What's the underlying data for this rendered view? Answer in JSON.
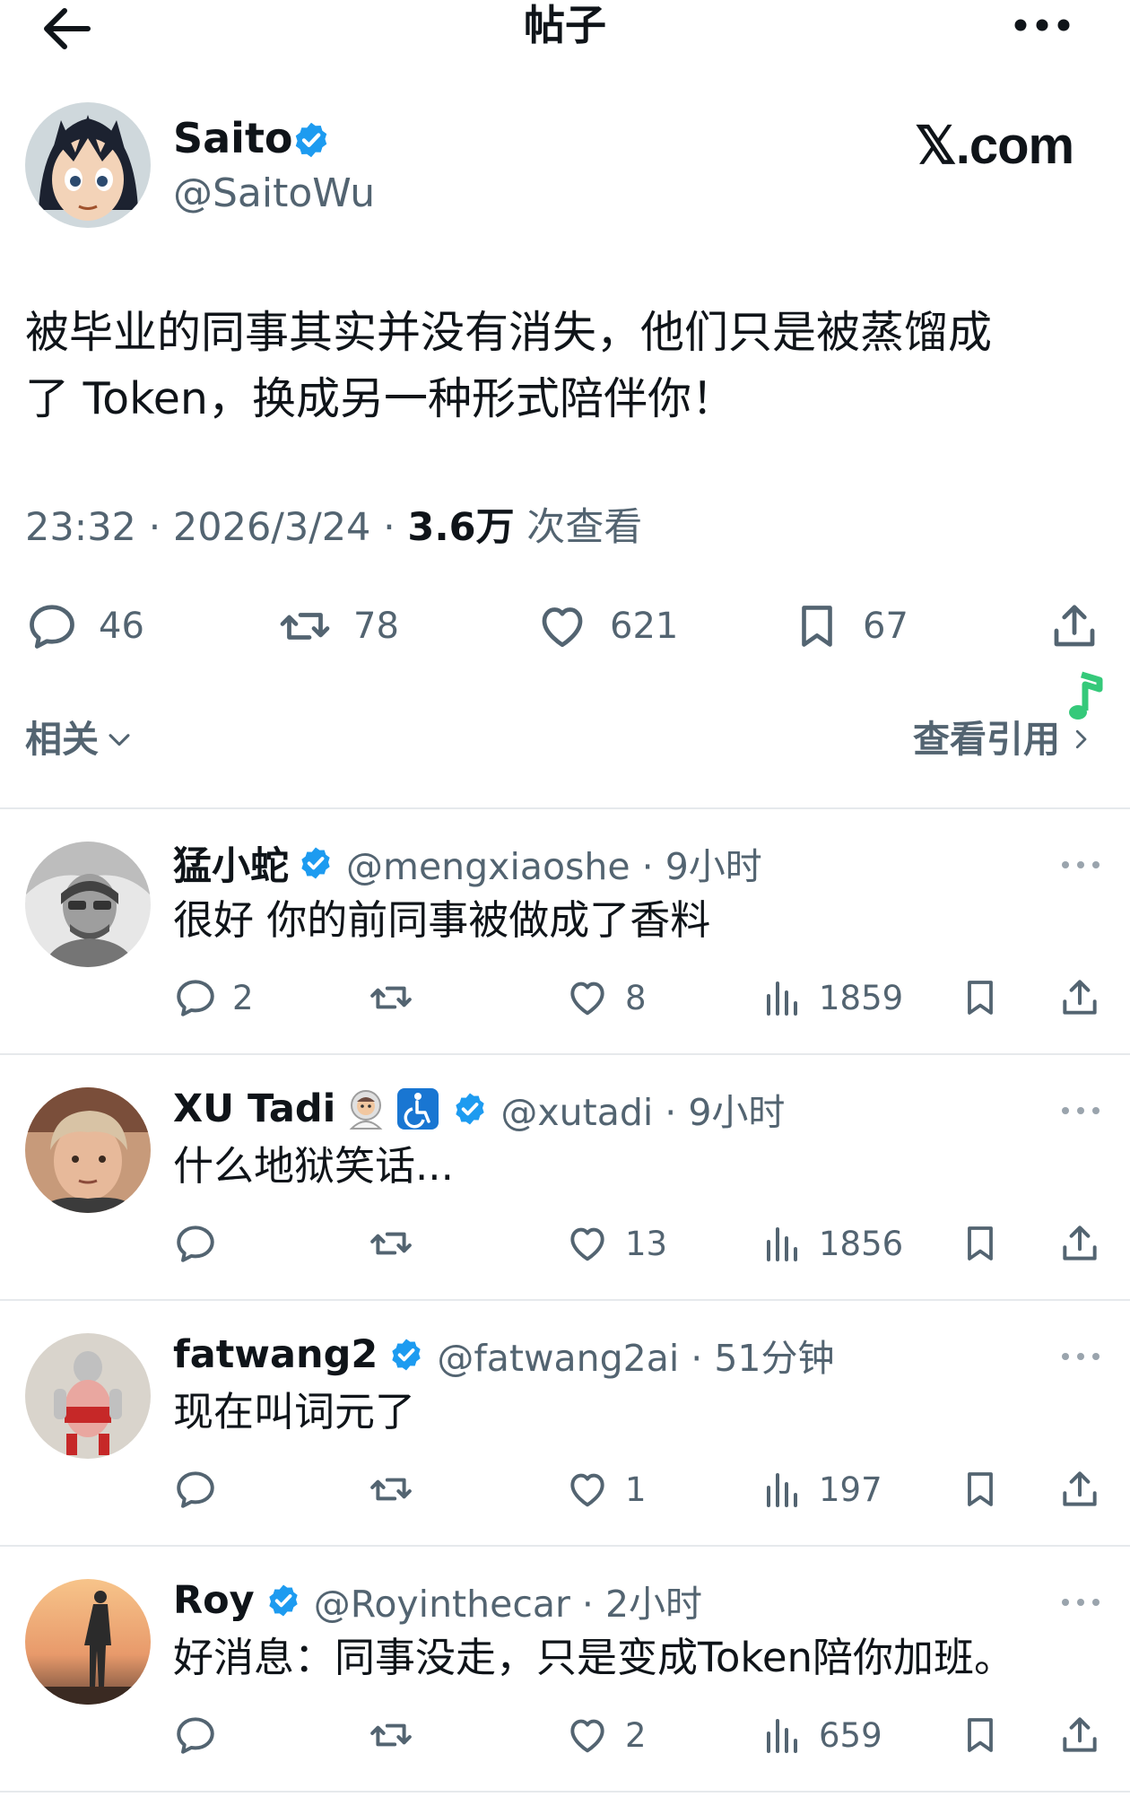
{
  "header": {
    "title": "帖子"
  },
  "post": {
    "author_name": "Saito",
    "author_handle": "@SaitoWu",
    "brand": "𝕏.com",
    "text_line1": "被毕业的同事其实并没有消失，他们只是被蒸馏成",
    "text_line2": "了 Token，换成另一种形式陪伴你！",
    "time": "23:32 · 2026/3/24 · ",
    "views_count": "3.6万",
    "views_label": " 次查看",
    "replies": "46",
    "reposts": "78",
    "likes": "621",
    "bookmarks": "67"
  },
  "related": {
    "label": "相关",
    "view_quotes": "查看引用"
  },
  "replies": [
    {
      "name": "猛小蛇",
      "handle": "@mengxiaoshe · 9小时",
      "text": "很好 你的前同事被做成了香料",
      "replies": "2",
      "reposts": "",
      "likes": "8",
      "views": "1859"
    },
    {
      "name": "XU Tadi",
      "handle": "@xutadi · 9小时",
      "text": "什么地狱笑话...",
      "replies": "",
      "reposts": "",
      "likes": "13",
      "views": "1856"
    },
    {
      "name": "fatwang2",
      "handle": "@fatwang2ai · 51分钟",
      "text": "现在叫词元了",
      "replies": "",
      "reposts": "",
      "likes": "1",
      "views": "197"
    },
    {
      "name": "Roy",
      "handle": "@Royinthecar · 2小时",
      "text": "好消息：同事没走，只是变成Token陪你加班。",
      "replies": "",
      "reposts": "",
      "likes": "2",
      "views": "659"
    }
  ],
  "colors": {
    "verified": "#1d9bf0",
    "text": "#0f1419",
    "secondary": "#536471"
  }
}
